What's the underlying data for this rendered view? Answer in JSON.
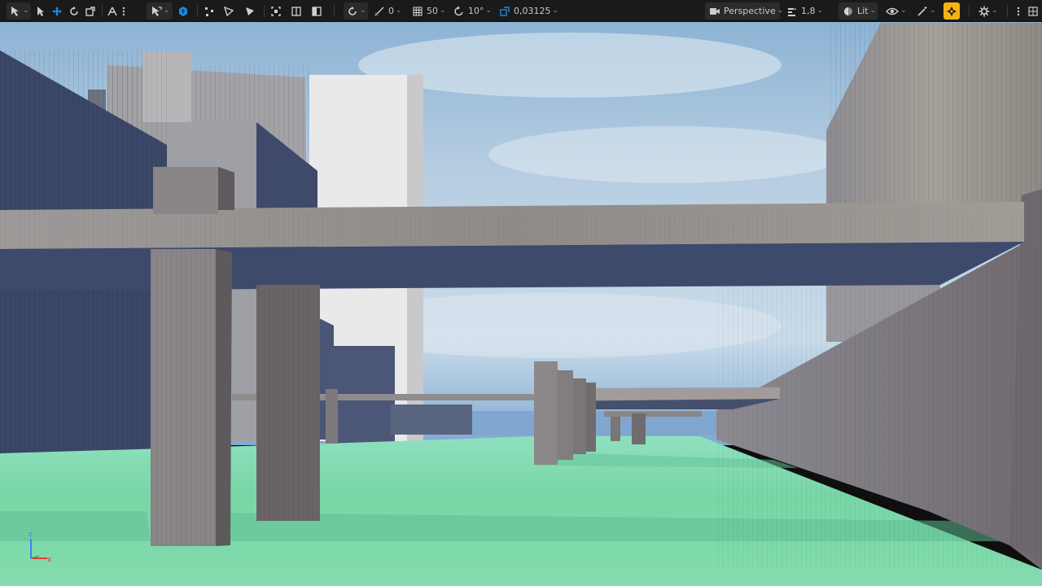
{
  "toolbar": {
    "translate_snap": {
      "value": "0",
      "icon": "angle-snap-icon"
    },
    "grid_snap": {
      "value": "50",
      "icon": "grid-snap-icon"
    },
    "rotation_snap": {
      "value": "10°",
      "icon": "rotation-snap-icon"
    },
    "scale_snap": {
      "value": "0,03125",
      "icon": "scale-snap-icon"
    },
    "view_mode": {
      "label": "Perspective",
      "icon": "camera-icon"
    },
    "camera_speed": {
      "value": "1,8",
      "icon": "camera-speed-icon"
    },
    "lighting_mode": {
      "label": "Lit",
      "icon": "lit-sphere-icon"
    }
  },
  "axis": {
    "z_label": "z",
    "x_label": "x"
  },
  "colors": {
    "toolbar_bg": "#1a1a1a",
    "accent_active": "#1e88e5",
    "snap_highlight": "#f5b416",
    "ground": "#7fd8a8",
    "sky_top": "#8eb4d6"
  }
}
